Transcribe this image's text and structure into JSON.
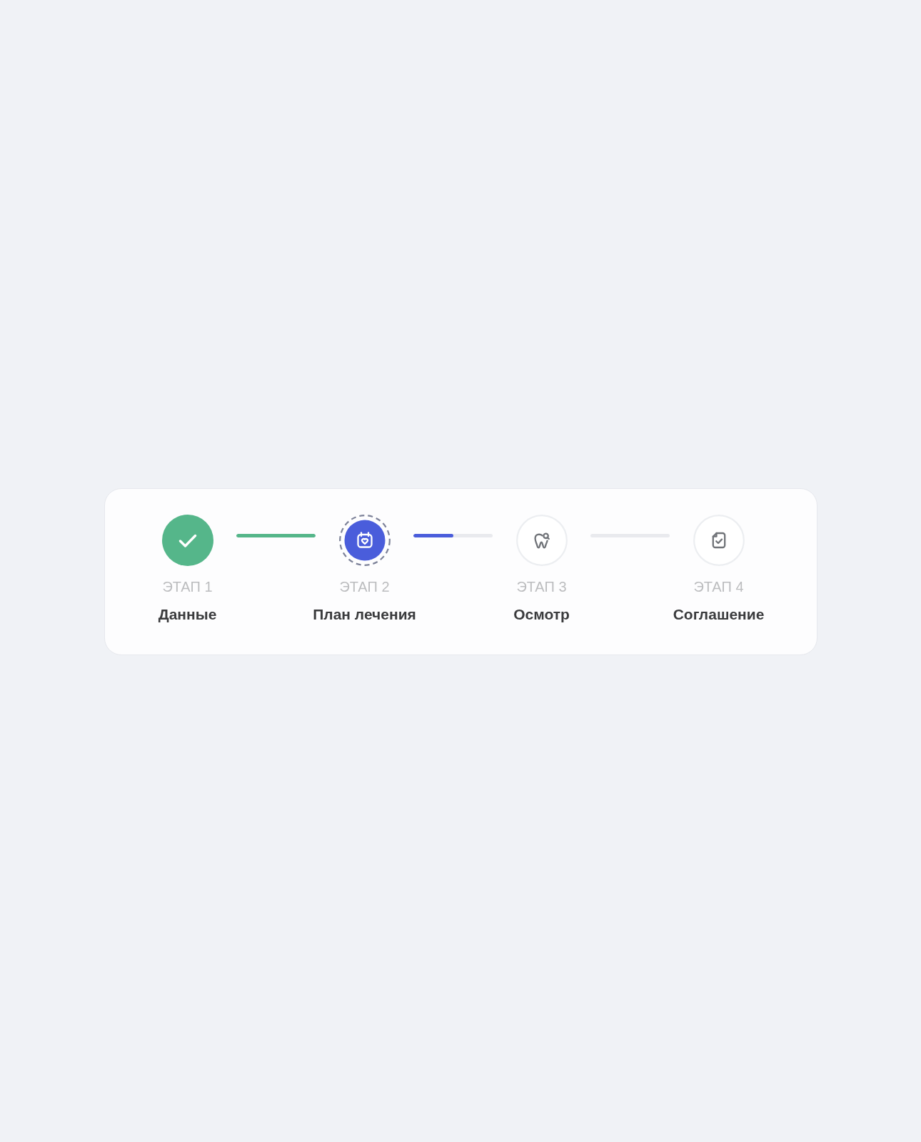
{
  "steps": [
    {
      "label": "ЭТАП 1",
      "name": "Данные",
      "completed": true,
      "selected": false
    },
    {
      "label": "ЭТАП 2",
      "name": "План лечения",
      "completed": false,
      "selected": true
    },
    {
      "label": "ЭТАП 3",
      "name": "Осмотр",
      "completed": false,
      "selected": false
    },
    {
      "label": "ЭТАП 4",
      "name": "Соглашение",
      "completed": false,
      "selected": false
    }
  ],
  "connectors": [
    {
      "level": 1
    },
    {
      "level": 0.5
    },
    {
      "level": 0
    }
  ]
}
